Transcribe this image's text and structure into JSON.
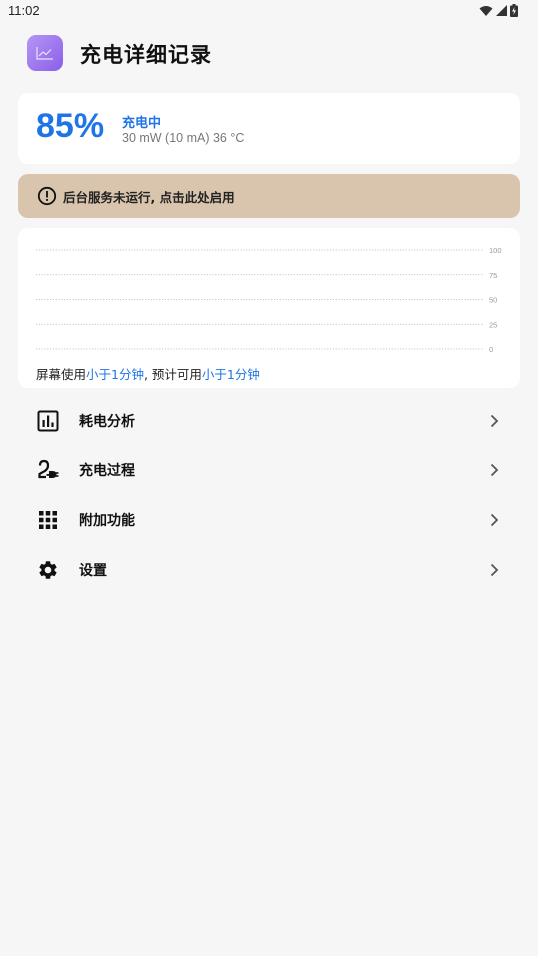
{
  "status_bar": {
    "time": "11:02"
  },
  "header": {
    "title": "充电详细记录"
  },
  "battery": {
    "percent": "85%",
    "state": "充电中",
    "detail": "30 mW (10 mA) 36 °C"
  },
  "warning": {
    "text": "后台服务未运行, 点击此处启用"
  },
  "chart": {
    "y_ticks": [
      "100",
      "75",
      "50",
      "25",
      "0"
    ]
  },
  "chart_data": {
    "type": "line",
    "title": "",
    "xlabel": "",
    "ylabel": "",
    "ylim": [
      0,
      100
    ],
    "y_ticks": [
      100,
      75,
      50,
      25,
      0
    ],
    "grid": true,
    "series": []
  },
  "usage": {
    "prefix": "屏幕使用",
    "screen_value": "小于1分钟",
    "middle": ", 预计可用",
    "remaining_value": "小于1分钟"
  },
  "menu": [
    {
      "label": "耗电分析",
      "icon": "bar-chart-icon"
    },
    {
      "label": "充电过程",
      "icon": "charging-cable-icon"
    },
    {
      "label": "附加功能",
      "icon": "grid-apps-icon"
    },
    {
      "label": "设置",
      "icon": "gear-icon"
    }
  ],
  "colors": {
    "accent": "#1f74e6",
    "warning_bg": "#d9c4ad",
    "app_icon": "#9b72ee",
    "background": "#f6f6f6"
  }
}
